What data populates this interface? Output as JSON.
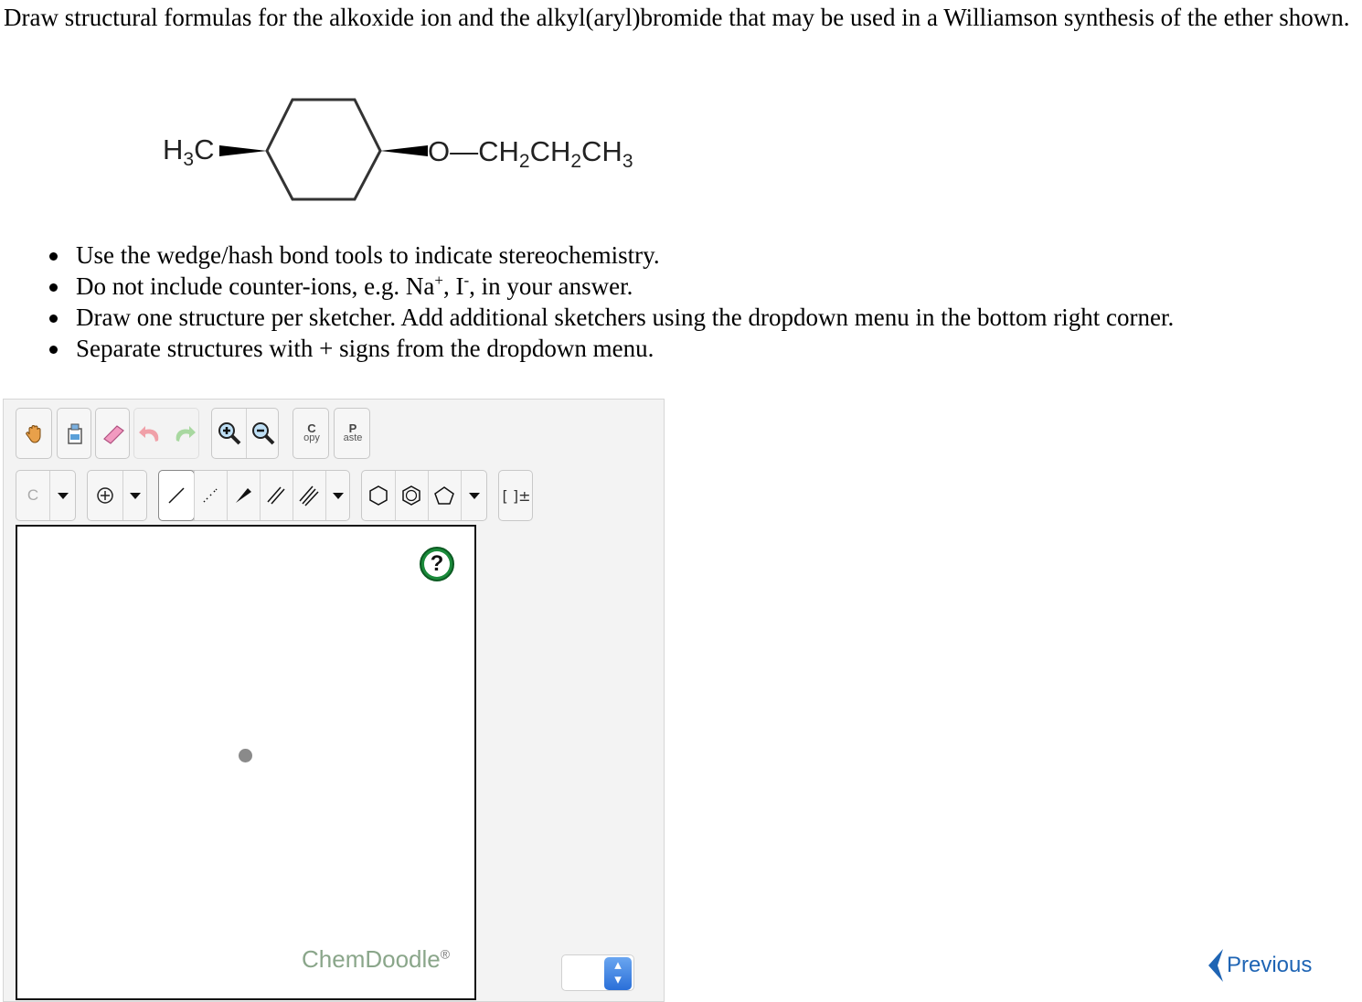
{
  "question": {
    "text": "Draw structural formulas for the alkoxide ion and the alkyl(aryl)bromide that may be used in a Williamson synthesis of the ether shown."
  },
  "molecule": {
    "left_group": "H3C",
    "right_group": "O—CH2CH2CH3"
  },
  "instructions": {
    "items": [
      "Use the wedge/hash bond tools to indicate stereochemistry.",
      "Do not include counter-ions, e.g. Na+, I-, in your answer.",
      "Draw one structure per sketcher. Add additional sketchers using the dropdown menu in the bottom right corner.",
      "Separate structures with + signs from the dropdown menu."
    ],
    "item2_parts": {
      "before": "Do not include counter-ions, e.g. Na",
      "plus": "+",
      "mid": ", I",
      "minus": "-",
      "after": ", in your answer."
    }
  },
  "toolbar": {
    "copy_top": "C",
    "copy_bottom": "opy",
    "paste_top": "P",
    "paste_bottom": "aste",
    "element_label": "C",
    "bracket_label": "[ ]±",
    "icons": [
      "hand-icon",
      "clear-icon",
      "eraser-icon",
      "undo-icon",
      "redo-icon",
      "zoom-in-icon",
      "zoom-out-icon",
      "charge-plus-icon",
      "single-bond-icon",
      "hash-bond-icon",
      "wedge-bond-icon",
      "double-bond-icon",
      "triple-bond-icon",
      "hexagon-icon",
      "benzene-icon",
      "pentagon-icon"
    ]
  },
  "canvas": {
    "help_label": "?",
    "brand": "ChemDoodle",
    "brand_mark": "®"
  },
  "navigation": {
    "previous_label": "Previous"
  },
  "colors": {
    "link": "#1e64b4",
    "help_green": "#1a8a3a",
    "brand_green": "#8aa68a"
  }
}
